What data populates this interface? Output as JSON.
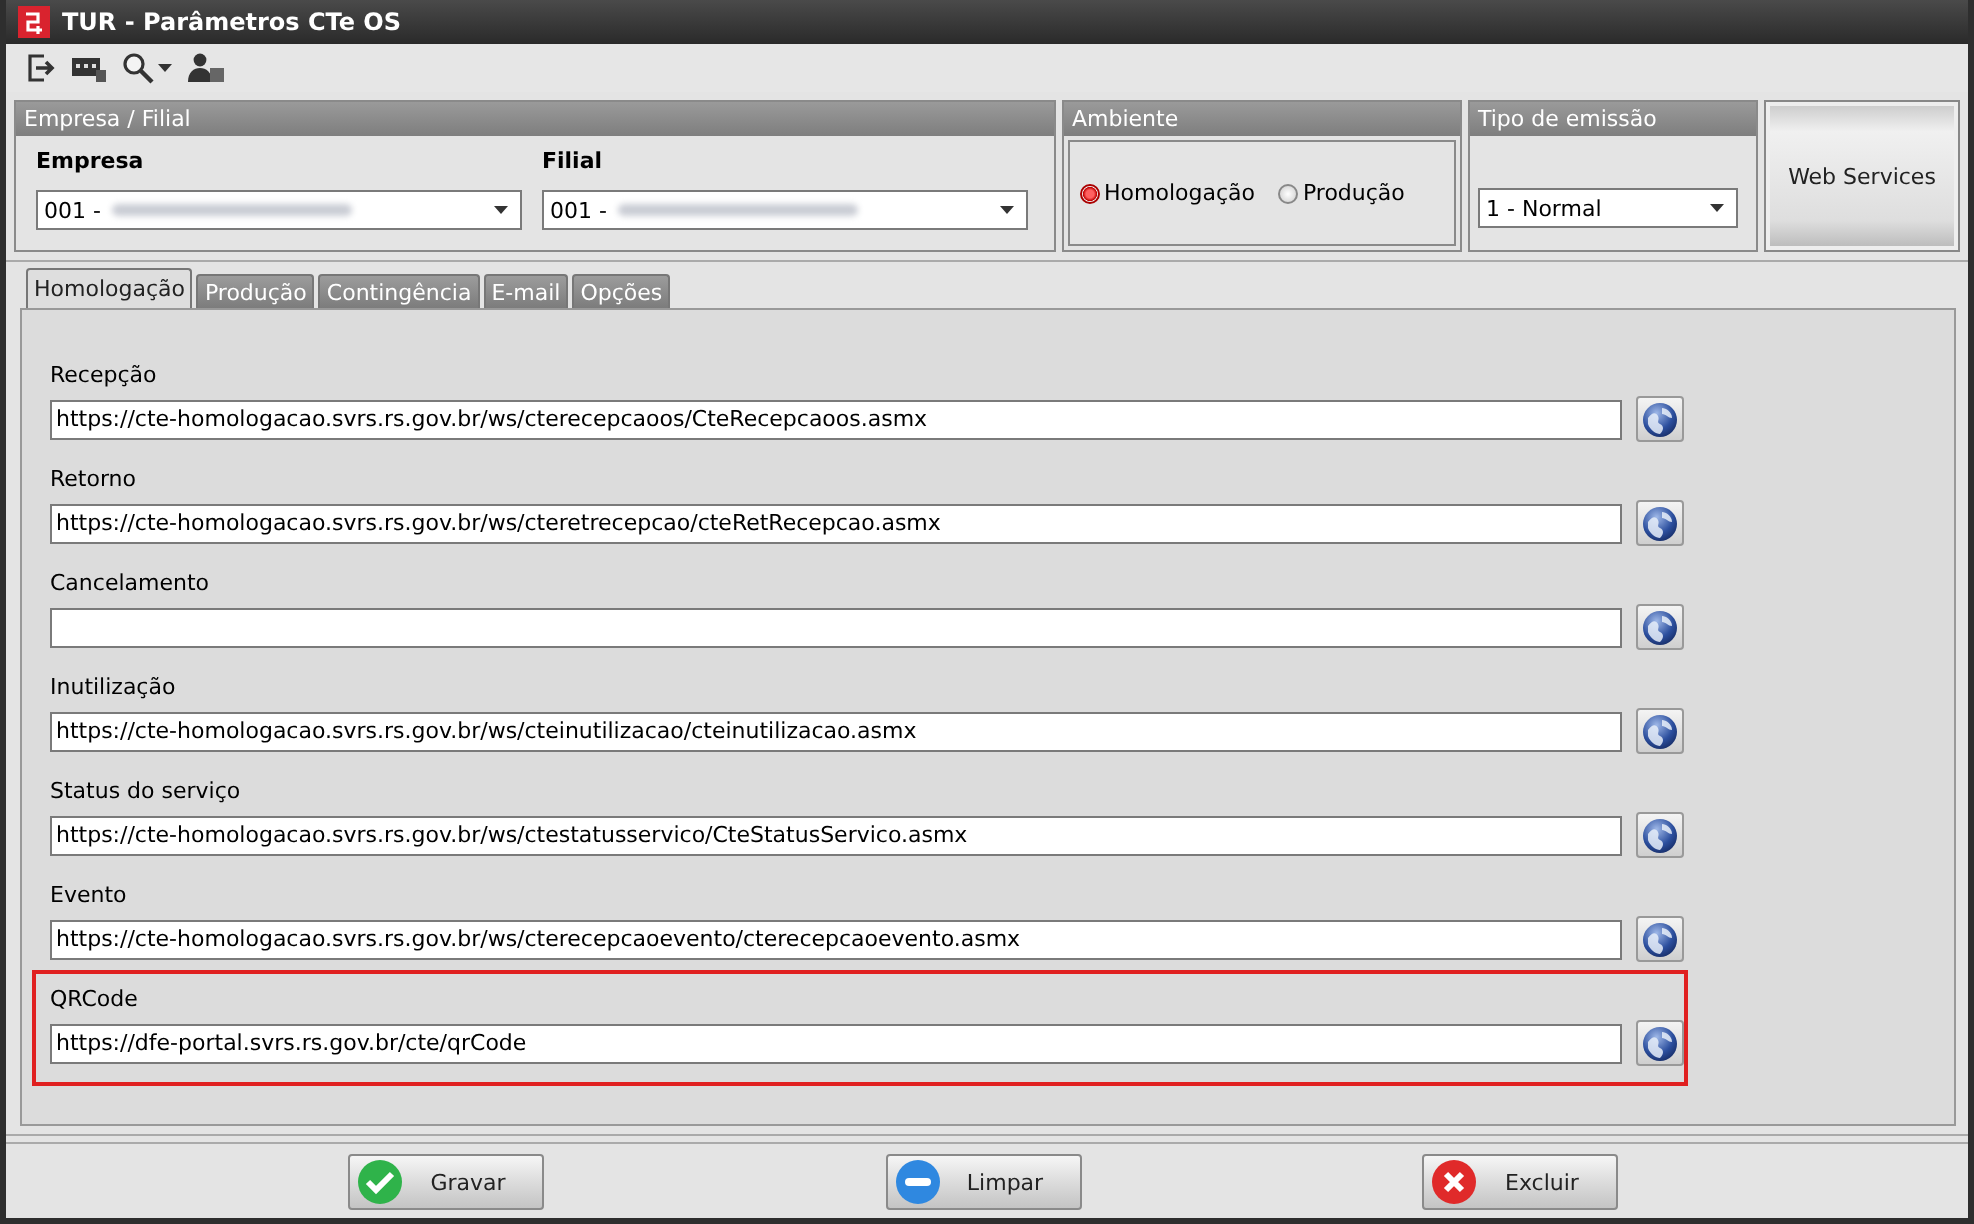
{
  "window": {
    "title": "TUR - Parâmetros CTe OS"
  },
  "empresa_filial": {
    "title": "Empresa / Filial",
    "fields": [
      {
        "label": "Empresa",
        "value": "001 -",
        "redacted": true
      },
      {
        "label": "Filial",
        "value": "001 -",
        "redacted": true
      }
    ]
  },
  "ambiente": {
    "title": "Ambiente",
    "options": [
      {
        "label": "Homologação",
        "selected": true
      },
      {
        "label": "Produção",
        "selected": false
      }
    ]
  },
  "tipo_emissao": {
    "title": "Tipo de emissão",
    "value": "1 - Normal"
  },
  "web_services_button": "Web Services",
  "tabs": [
    {
      "label": "Homologação",
      "selected": true
    },
    {
      "label": "Produção",
      "selected": false
    },
    {
      "label": "Contingência",
      "selected": false
    },
    {
      "label": "E-mail",
      "selected": false
    },
    {
      "label": "Opções",
      "selected": false
    }
  ],
  "services": [
    {
      "label": "Recepção",
      "value": "https://cte-homologacao.svrs.rs.gov.br/ws/cterecepcaoos/CteRecepcaoos.asmx",
      "highlighted": false
    },
    {
      "label": "Retorno",
      "value": "https://cte-homologacao.svrs.rs.gov.br/ws/cteretrecepcao/cteRetRecepcao.asmx",
      "highlighted": false
    },
    {
      "label": "Cancelamento",
      "highlighted": false
    },
    {
      "label": "Inutilização",
      "value": "https://cte-homologacao.svrs.rs.gov.br/ws/cteinutilizacao/cteinutilizacao.asmx",
      "highlighted": false
    },
    {
      "label": "Status do serviço",
      "value": "https://cte-homologacao.svrs.rs.gov.br/ws/ctestatusservico/CteStatusServico.asmx",
      "highlighted": false
    },
    {
      "label": "Evento",
      "value": "https://cte-homologacao.svrs.rs.gov.br/ws/cterecepcaoevento/cterecepcaoevento.asmx",
      "highlighted": false
    },
    {
      "label": "QRCode",
      "value": "https://dfe-portal.svrs.rs.gov.br/cte/qrCode",
      "highlighted": true
    }
  ],
  "buttons": [
    {
      "kind": "confirm",
      "label": "Gravar"
    },
    {
      "kind": "clear",
      "label": "Limpar"
    },
    {
      "kind": "delete",
      "label": "Excluir"
    }
  ]
}
